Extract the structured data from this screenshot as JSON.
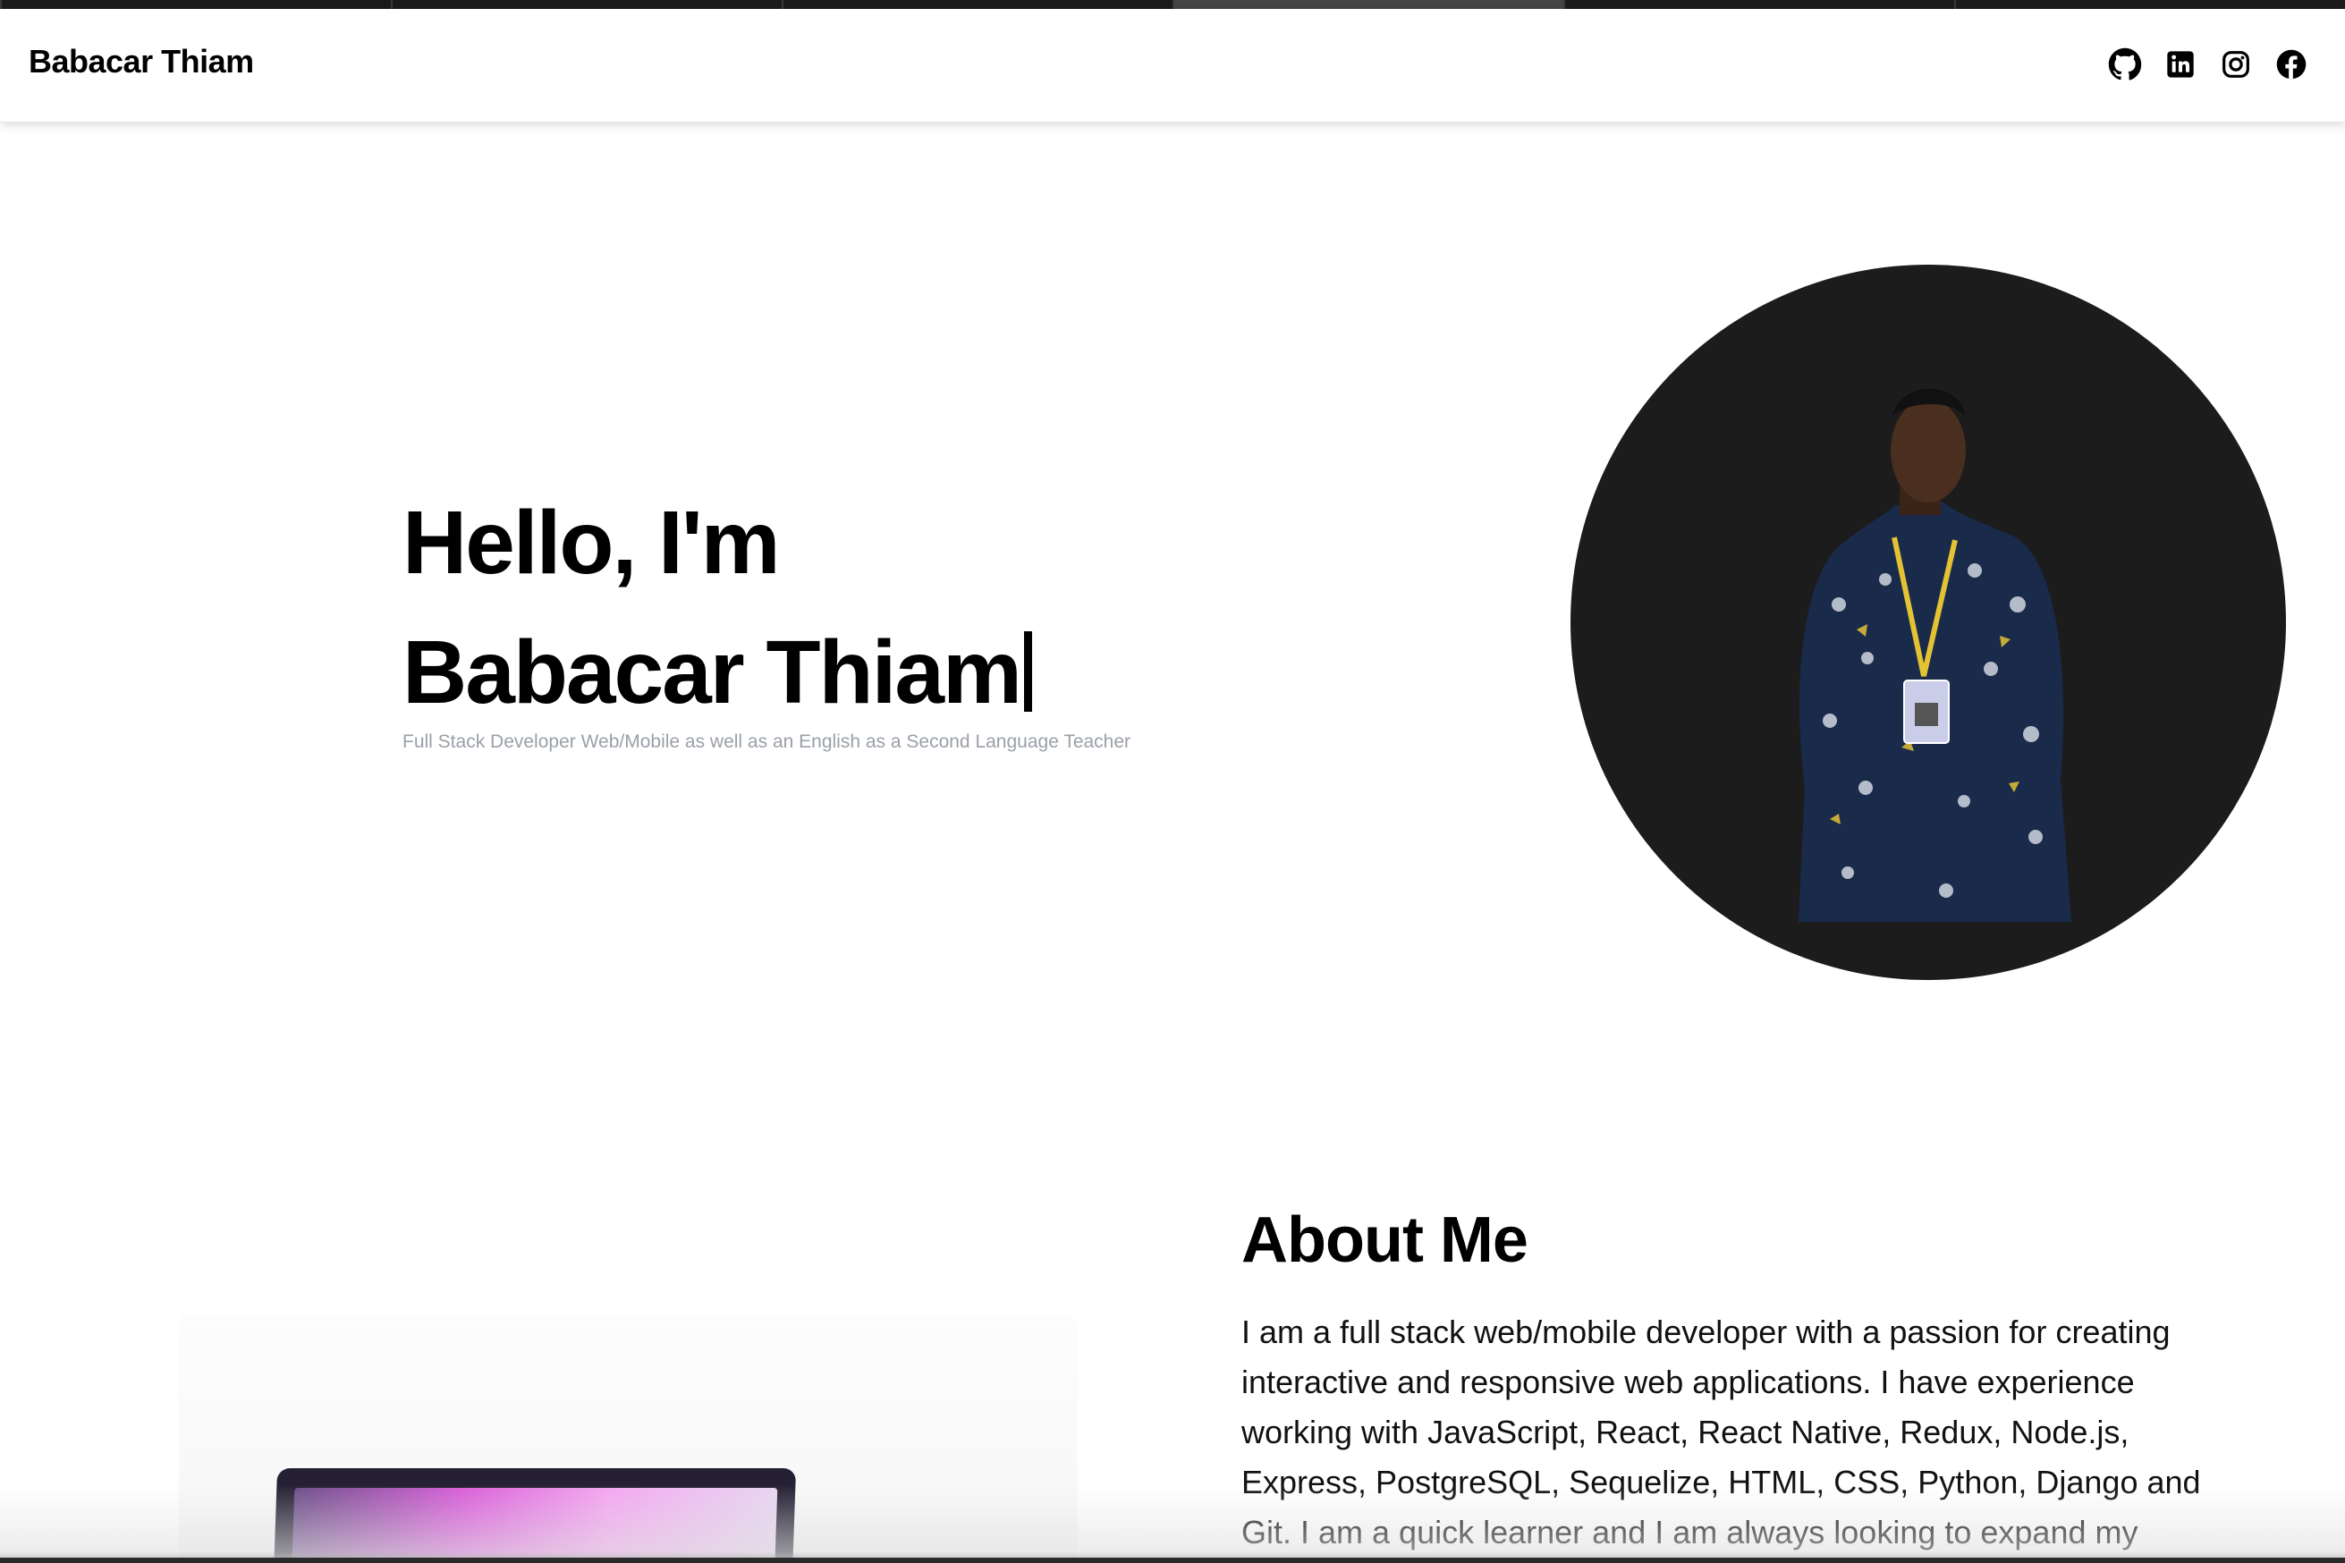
{
  "header": {
    "brand": "Babacar Thiam",
    "social": [
      {
        "icon": "github-icon"
      },
      {
        "icon": "linkedin-icon"
      },
      {
        "icon": "instagram-icon"
      },
      {
        "icon": "facebook-icon"
      }
    ]
  },
  "hero": {
    "greeting": "Hello, I'm",
    "name": "Babacar Thiam",
    "subtitle": "Full Stack Developer Web/Mobile as well as an English as a Second Language Teacher"
  },
  "about": {
    "title": "About Me",
    "text": "I am a full stack web/mobile developer with a passion for creating interactive and responsive web applications. I have experience working with JavaScript, React, React Native, Redux, Node.js, Express, PostgreSQL, Sequelize, HTML, CSS, Python, Django and Git. I am a quick learner and I am always looking to expand my"
  },
  "colors": {
    "avatar_bg": "#1c1c1c",
    "subtitle": "#9aa0a8",
    "shirt": "#1a2a4a",
    "lanyard": "#e3c234"
  }
}
